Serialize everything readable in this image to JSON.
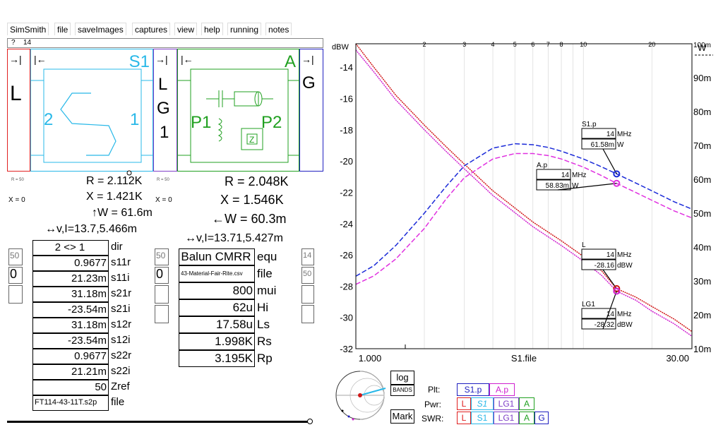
{
  "menu": [
    "SimSmith",
    "file",
    "saveImages",
    "captures",
    "view",
    "help",
    "running",
    "notes"
  ],
  "command": {
    "prompt": "?",
    "value": "14"
  },
  "schematic": {
    "L": {
      "left": "→|",
      "label": "L"
    },
    "S1": {
      "left": "|←",
      "title": "S1",
      "port2": "2",
      "port1": "1"
    },
    "LG1": {
      "left": "→|",
      "l1": "L",
      "l2": "G",
      "l3": "1"
    },
    "A": {
      "left": "|←",
      "title": "A",
      "p1": "P1",
      "p2": "P2"
    },
    "G": {
      "left": "→|",
      "label": "G"
    }
  },
  "readouts": {
    "left": {
      "R": "R = 2.112K",
      "X": "X = 1.421K",
      "W": "↑W = 61.6m",
      "vi": "↔v,I=13.7,5.466m",
      "rtag": "R = 50",
      "xtag": "X = 0"
    },
    "right": {
      "R": "R = 2.048K",
      "X": "X = 1.546K",
      "W": "←W = 60.3m",
      "vi": "↔v,I=13.71,5.427m",
      "rtag": "R = 50",
      "xtag": "X = 0"
    }
  },
  "s1_params": [
    {
      "value": "2 <> 1",
      "label": "dir"
    },
    {
      "value": "0.9677",
      "label": "s11r"
    },
    {
      "value": "21.23m",
      "label": "s11i"
    },
    {
      "value": "31.18m",
      "label": "s21r"
    },
    {
      "value": "-23.54m",
      "label": "s21i"
    },
    {
      "value": "31.18m",
      "label": "s12r"
    },
    {
      "value": "-23.54m",
      "label": "s12i"
    },
    {
      "value": "0.9677",
      "label": "s22r"
    },
    {
      "value": "21.21m",
      "label": "s22i"
    },
    {
      "value": "50",
      "label": "Zref"
    },
    {
      "value": "FT114-43-11T.s2p",
      "label": "file"
    }
  ],
  "a_params": [
    {
      "value": "Balun CMRR",
      "label": "equ"
    },
    {
      "value": "43-Material-Fair-Rite.csv",
      "label": "file"
    },
    {
      "value": "800",
      "label": "mui"
    },
    {
      "value": "62u",
      "label": "Hi"
    },
    {
      "value": "17.58u",
      "label": "Ls"
    },
    {
      "value": "1.998K",
      "label": "Rs"
    },
    {
      "value": "3.195K",
      "label": "Rp"
    }
  ],
  "stubs": {
    "left": [
      "50",
      "0"
    ],
    "midleft": [
      "50",
      "0"
    ],
    "right": [
      "14",
      "50"
    ]
  },
  "chart_data": {
    "type": "line",
    "title": "",
    "xlabel": "S1.file",
    "xscale": "log",
    "xlim": [
      1.0,
      30.0
    ],
    "x_ticks": [
      "2",
      "3",
      "4",
      "5",
      "6",
      "7",
      "8",
      "10",
      "20"
    ],
    "x_end_labels": [
      "1.000",
      "30.00"
    ],
    "y_left_unit": "dBW",
    "ylim_left": [
      -32,
      -12.5
    ],
    "y_left_ticks": [
      "-14",
      "-16",
      "-18",
      "-20",
      "-22",
      "-24",
      "-26",
      "-28",
      "-30",
      "-32"
    ],
    "y_right_unit": "W",
    "ylim_right": [
      0.01,
      0.1
    ],
    "y_right_ticks": [
      "100m",
      "90m",
      "80m",
      "70m",
      "60m",
      "50m",
      "40m",
      "30m",
      "20m",
      "10m"
    ],
    "series": [
      {
        "name": "L",
        "color": "#d01818",
        "style": "dotted",
        "axis": "left",
        "x": [
          1.0,
          1.2,
          1.5,
          2.0,
          2.5,
          3.0,
          4.0,
          5.0,
          6.0,
          8.0,
          10.0,
          12.0,
          14.0,
          17.0,
          20.0,
          25.0,
          30.0
        ],
        "y": [
          -12.5,
          -14.0,
          -15.8,
          -17.7,
          -19.1,
          -20.2,
          -21.9,
          -23.0,
          -23.9,
          -25.1,
          -26.1,
          -27.0,
          -28.16,
          -28.7,
          -29.3,
          -30.1,
          -30.9
        ]
      },
      {
        "name": "LG1",
        "color": "#d020d0",
        "style": "dotted",
        "axis": "left",
        "x": [
          1.0,
          1.2,
          1.5,
          2.0,
          2.5,
          3.0,
          4.0,
          5.0,
          6.0,
          8.0,
          10.0,
          12.0,
          14.0,
          17.0,
          20.0,
          25.0,
          30.0
        ],
        "y": [
          -12.9,
          -14.3,
          -16.1,
          -18.0,
          -19.4,
          -20.5,
          -22.2,
          -23.3,
          -24.2,
          -25.4,
          -26.4,
          -27.3,
          -28.32,
          -28.9,
          -29.6,
          -30.4,
          -31.2
        ]
      },
      {
        "name": "S1.p",
        "color": "#1a2ad8",
        "style": "dashed",
        "axis": "right",
        "x": [
          1.0,
          1.2,
          1.5,
          2.0,
          2.5,
          3.0,
          4.0,
          5.0,
          6.0,
          7.0,
          8.0,
          10.0,
          12.0,
          14.0,
          17.0,
          20.0,
          25.0,
          30.0
        ],
        "y": [
          0.0314,
          0.0345,
          0.0405,
          0.05,
          0.058,
          0.064,
          0.0692,
          0.0705,
          0.0702,
          0.0694,
          0.0683,
          0.066,
          0.0637,
          0.0616,
          0.0589,
          0.0566,
          0.0534,
          0.0512
        ]
      },
      {
        "name": "A.p",
        "color": "#e030e0",
        "style": "dashed",
        "axis": "right",
        "x": [
          1.0,
          1.2,
          1.5,
          2.0,
          2.5,
          3.0,
          4.0,
          5.0,
          6.0,
          7.0,
          8.0,
          10.0,
          12.0,
          14.0,
          17.0,
          20.0,
          25.0,
          30.0
        ],
        "y": [
          0.029,
          0.0315,
          0.0365,
          0.0455,
          0.0543,
          0.0605,
          0.066,
          0.0676,
          0.0676,
          0.067,
          0.066,
          0.0636,
          0.0611,
          0.0588,
          0.0561,
          0.0538,
          0.0507,
          0.0486
        ]
      }
    ],
    "markers": [
      {
        "name": "S1.p",
        "freq": "14",
        "funit": "MHz",
        "value": "61.58m",
        "vunit": "W"
      },
      {
        "name": "A.p",
        "freq": "14",
        "funit": "MHz",
        "value": "58.83m",
        "vunit": "W"
      },
      {
        "name": "L",
        "freq": "14",
        "funit": "MHz",
        "value": "-28.16",
        "vunit": "dBW"
      },
      {
        "name": "LG1",
        "freq": "14",
        "funit": "MHz",
        "value": "-28.32",
        "vunit": "dBW"
      }
    ],
    "legend": {
      "plt_label": "Plt:",
      "pwr_label": "Pwr:",
      "swr_label": "SWR:",
      "plt": [
        "S1.p",
        "A.p"
      ],
      "pwr": [
        "L",
        "S1",
        "LG1",
        "A"
      ],
      "swr": [
        "L",
        "S1",
        "LG1",
        "A",
        "G"
      ]
    }
  },
  "controls": {
    "log": "log",
    "bands": "BANDS",
    "mark": "Mark"
  },
  "colors": {
    "red": "#e02020",
    "cyan": "#28b8e8",
    "purple": "#8040c8",
    "green": "#20a020",
    "blue": "#2020c0",
    "magenta": "#d020d0"
  }
}
